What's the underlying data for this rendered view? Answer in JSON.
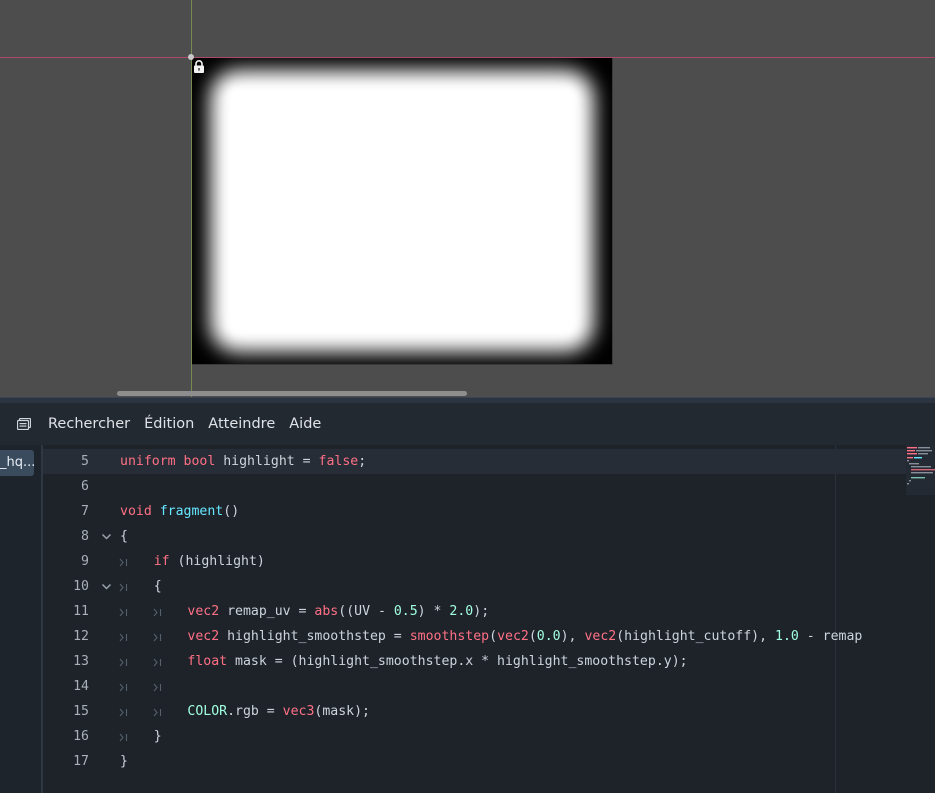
{
  "menu": {
    "items": [
      "Rechercher",
      "Édition",
      "Atteindre",
      "Aide"
    ]
  },
  "script_list": {
    "active_tab": "_hq..."
  },
  "editor": {
    "lines": [
      {
        "num": "5",
        "fold": "",
        "indent": 0,
        "current": true,
        "tokens": [
          [
            "kw",
            "uniform"
          ],
          [
            "id",
            " "
          ],
          [
            "ty",
            "bool"
          ],
          [
            "id",
            " highlight = "
          ],
          [
            "kw",
            "false"
          ],
          [
            "id",
            ";"
          ]
        ]
      },
      {
        "num": "6",
        "fold": "",
        "indent": 0,
        "tokens": []
      },
      {
        "num": "7",
        "fold": "",
        "indent": 0,
        "tokens": [
          [
            "kw",
            "void"
          ],
          [
            "id",
            " "
          ],
          [
            "fn",
            "fragment"
          ],
          [
            "id",
            "()"
          ]
        ]
      },
      {
        "num": "8",
        "fold": "v",
        "indent": 0,
        "tokens": [
          [
            "id",
            "{"
          ]
        ]
      },
      {
        "num": "9",
        "fold": "",
        "indent": 1,
        "tokens": [
          [
            "kw",
            "if"
          ],
          [
            "id",
            " (highlight)"
          ]
        ]
      },
      {
        "num": "10",
        "fold": "v",
        "indent": 1,
        "tokens": [
          [
            "id",
            "{"
          ]
        ]
      },
      {
        "num": "11",
        "fold": "",
        "indent": 2,
        "tokens": [
          [
            "ty",
            "vec2"
          ],
          [
            "id",
            " remap_uv = "
          ],
          [
            "bi",
            "abs"
          ],
          [
            "id",
            "((UV - "
          ],
          [
            "num",
            "0.5"
          ],
          [
            "id",
            ") * "
          ],
          [
            "num",
            "2.0"
          ],
          [
            "id",
            ");"
          ]
        ]
      },
      {
        "num": "12",
        "fold": "",
        "indent": 2,
        "tokens": [
          [
            "ty",
            "vec2"
          ],
          [
            "id",
            " highlight_smoothstep = "
          ],
          [
            "bi",
            "smoothstep"
          ],
          [
            "id",
            "("
          ],
          [
            "ty",
            "vec2"
          ],
          [
            "id",
            "("
          ],
          [
            "num",
            "0.0"
          ],
          [
            "id",
            "), "
          ],
          [
            "ty",
            "vec2"
          ],
          [
            "id",
            "(highlight_cutoff), "
          ],
          [
            "num",
            "1.0"
          ],
          [
            "id",
            " - remap"
          ]
        ]
      },
      {
        "num": "13",
        "fold": "",
        "indent": 2,
        "tokens": [
          [
            "ty",
            "float"
          ],
          [
            "id",
            " mask = (highlight_smoothstep.x * highlight_smoothstep.y);"
          ]
        ]
      },
      {
        "num": "14",
        "fold": "",
        "indent": 2,
        "tokens": []
      },
      {
        "num": "15",
        "fold": "",
        "indent": 2,
        "tokens": [
          [
            "const",
            "COLOR"
          ],
          [
            "id",
            ".rgb = "
          ],
          [
            "ty",
            "vec3"
          ],
          [
            "id",
            "(mask);"
          ]
        ]
      },
      {
        "num": "16",
        "fold": "",
        "indent": 1,
        "tokens": [
          [
            "id",
            "}"
          ]
        ]
      },
      {
        "num": "17",
        "fold": "",
        "indent": 0,
        "tokens": [
          [
            "id",
            "}"
          ]
        ]
      }
    ]
  },
  "icons": {
    "menu_toggle": "script-panel-toggle-icon",
    "lock": "lock-icon"
  },
  "colors": {
    "viewport_bg": "#4d4d4d",
    "editor_bg": "#1e232a",
    "keyword": "#ff7085",
    "function": "#66e6ff",
    "number": "#a1ffe0"
  }
}
